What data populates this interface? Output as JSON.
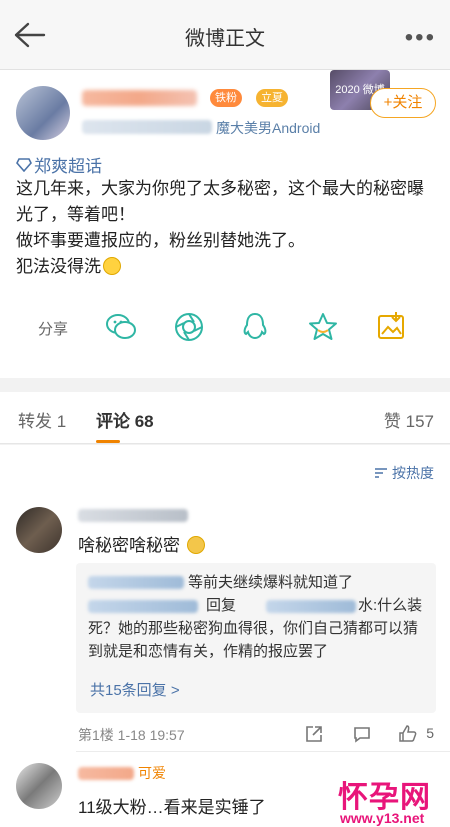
{
  "topbar": {
    "title": "微博正文",
    "more": "•••"
  },
  "post": {
    "badge_fan": "铁粉",
    "badge_vip": "立夏",
    "header_image_text": "2020 微博之夜",
    "follow_label": "+关注",
    "source": "魔大美男Android",
    "topic": "郑爽超话",
    "lines": [
      "这几年来，大家为你兜了太多秘密，这个最大的秘密曝光了，等着吧！",
      "做坏事要遭报应的，粉丝别替她洗了。",
      "犯法没得洗"
    ],
    "share_label": "分享"
  },
  "tabs": [
    {
      "label": "转发 1"
    },
    {
      "label": "评论 68"
    },
    {
      "label": "赞 157"
    }
  ],
  "comments": {
    "sort_label": "按热度",
    "c1": {
      "text": "啥秘密啥秘密",
      "reply_line1": "等前夫继续爆料就知道了",
      "reply_line2": "回复",
      "reply_line3": "水:什么装",
      "reply_body": "死？她的那些秘密狗血得很，你们自己猜都可以猜到就是和恋情有关，作精的报应罢了",
      "reply_more": "共15条回复 >",
      "meta": "第1楼 1-18 19:57",
      "likes": "5"
    },
    "c2": {
      "text": "11级大粉…看来是实锤了",
      "name_suffix": "可爱"
    }
  },
  "watermark": {
    "main": "怀孕网",
    "sub": "www.y13.net"
  },
  "colors": {
    "accent": "#f08300",
    "link": "#4b73a8",
    "watermark": "#e8157a"
  }
}
